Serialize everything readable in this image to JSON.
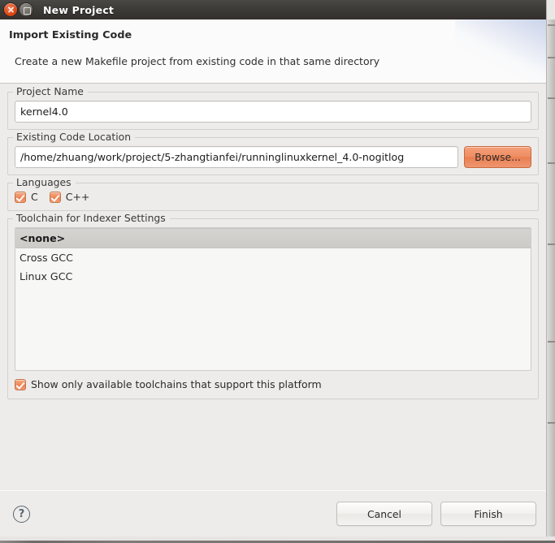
{
  "window": {
    "title": "New Project",
    "close_icon": "close-icon",
    "maximize_icon": "maximize-icon"
  },
  "header": {
    "title": "Import Existing Code",
    "description": "Create a new Makefile project from existing code in that same directory"
  },
  "project_name": {
    "legend": "Project Name",
    "value": "kernel4.0",
    "placeholder": ""
  },
  "code_location": {
    "legend": "Existing Code Location",
    "value": "/home/zhuang/work/project/5-zhangtianfei/runninglinuxkernel_4.0-nogitlog",
    "placeholder": "",
    "browse_label": "Browse..."
  },
  "languages": {
    "legend": "Languages",
    "items": [
      {
        "label": "C",
        "checked": true
      },
      {
        "label": "C++",
        "checked": true
      }
    ]
  },
  "toolchain": {
    "legend": "Toolchain for Indexer Settings",
    "items": [
      {
        "label": "<none>",
        "selected": true
      },
      {
        "label": "Cross GCC",
        "selected": false
      },
      {
        "label": "Linux GCC",
        "selected": false
      }
    ],
    "show_only": {
      "label": "Show only available toolchains that support this platform",
      "checked": true
    }
  },
  "footer": {
    "help_icon": "?",
    "cancel_label": "Cancel",
    "finish_label": "Finish"
  },
  "colors": {
    "accent_orange": "#ef8d63",
    "titlebar": "#3b3936",
    "close_button": "#dd4814",
    "dialog_bg": "#edecea",
    "header_bg": "#fbfbfb"
  }
}
